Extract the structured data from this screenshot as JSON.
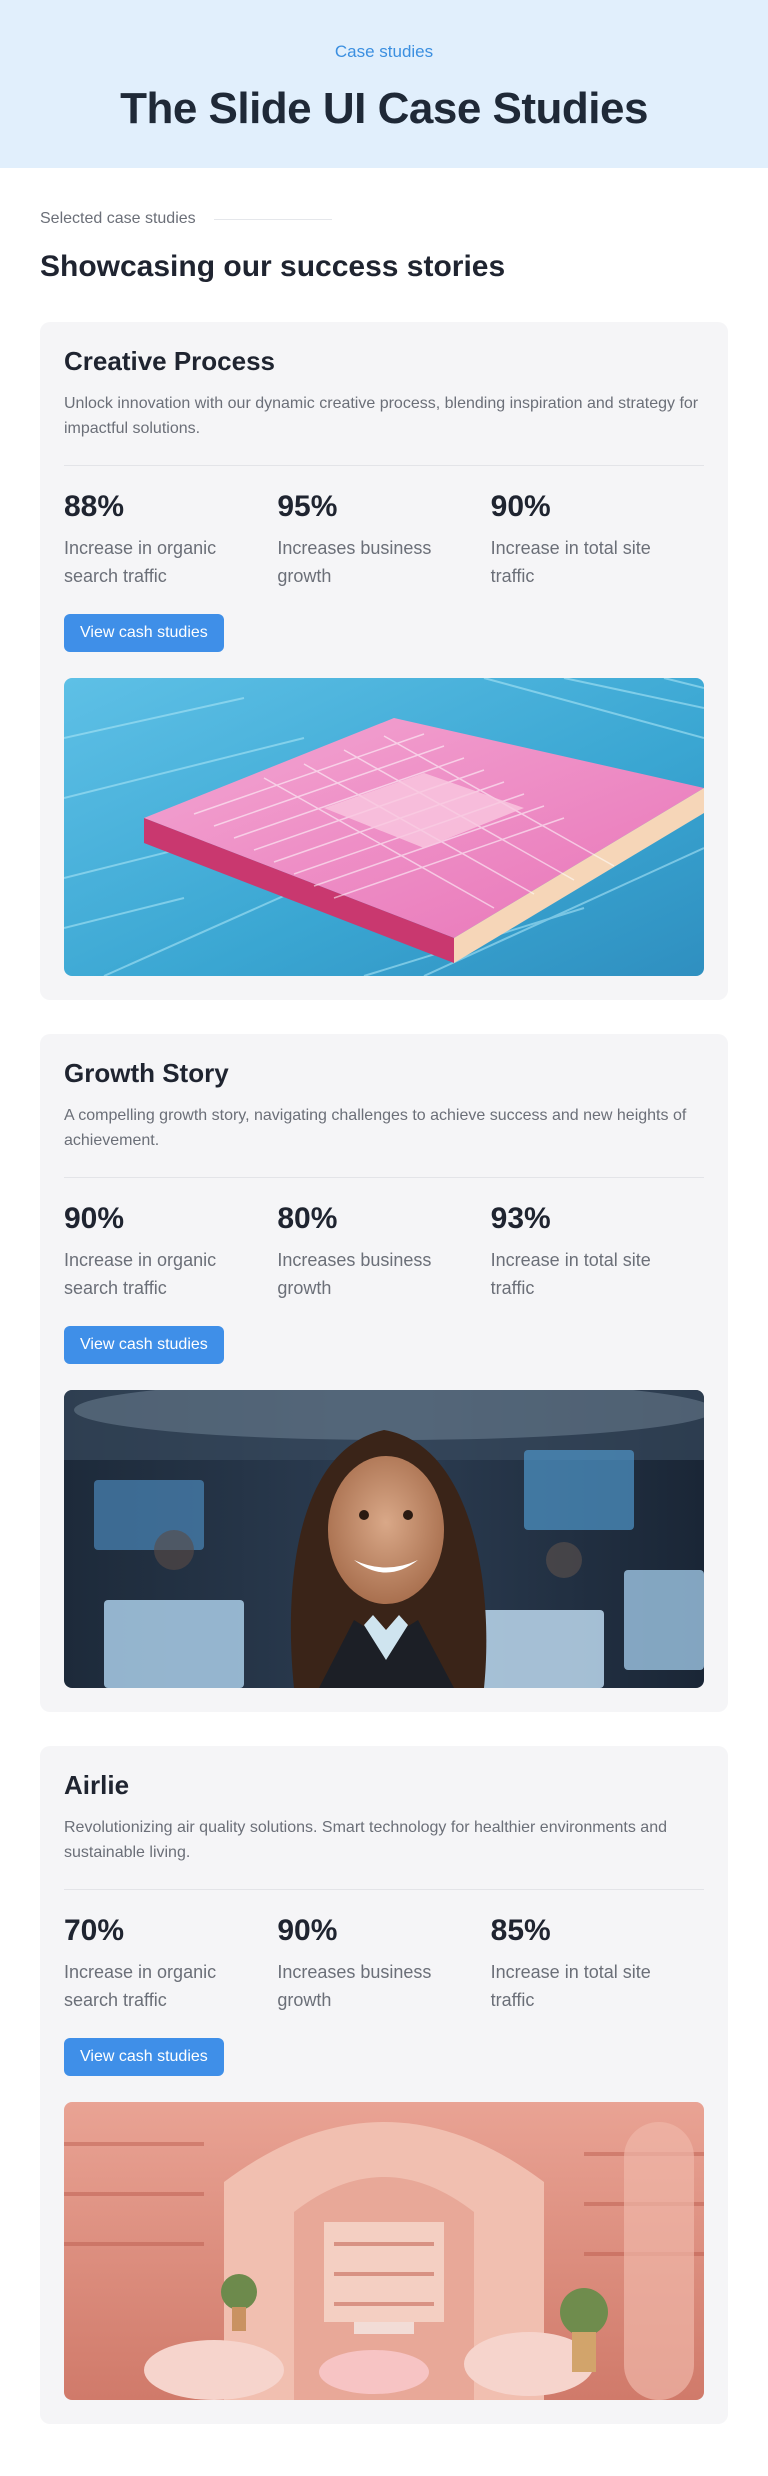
{
  "hero": {
    "eyebrow": "Case studies",
    "title": "The Slide UI Case Studies"
  },
  "intro": {
    "label": "Selected case studies",
    "heading": "Showcasing our success stories"
  },
  "cards": [
    {
      "title": "Creative Process",
      "description": "Unlock innovation with our dynamic creative process, blending inspiration and strategy for impactful solutions.",
      "stats": [
        {
          "value": "88%",
          "caption": "Increase in organic search traffic"
        },
        {
          "value": "95%",
          "caption": "Increases business growth"
        },
        {
          "value": "90%",
          "caption": "Increase in total site traffic"
        }
      ],
      "button": "View cash studies"
    },
    {
      "title": "Growth Story",
      "description": "A compelling growth story, navigating challenges to achieve success and new heights of achievement.",
      "stats": [
        {
          "value": "90%",
          "caption": "Increase in organic search traffic"
        },
        {
          "value": "80%",
          "caption": "Increases business growth"
        },
        {
          "value": "93%",
          "caption": "Increase in total site traffic"
        }
      ],
      "button": "View cash studies"
    },
    {
      "title": "Airlie",
      "description": "Revolutionizing air quality solutions. Smart technology for healthier environments and sustainable living.",
      "stats": [
        {
          "value": "70%",
          "caption": "Increase in organic search traffic"
        },
        {
          "value": "90%",
          "caption": "Increases business growth"
        },
        {
          "value": "85%",
          "caption": "Increase in total site traffic"
        }
      ],
      "button": "View cash studies"
    }
  ],
  "colors": {
    "accent": "#3f8fe8",
    "hero_bg": "#e1effc",
    "card_bg": "#f5f5f7"
  }
}
